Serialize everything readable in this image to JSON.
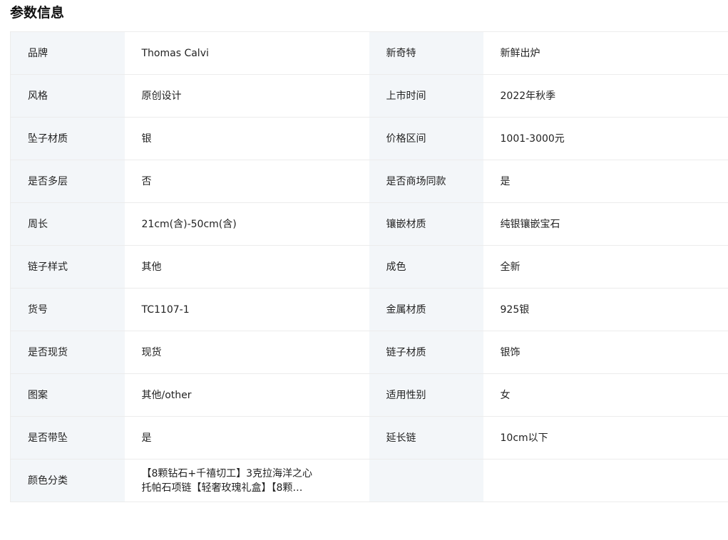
{
  "section": {
    "title": "参数信息"
  },
  "rows": [
    [
      {
        "label": "品牌",
        "value": "Thomas Calvi"
      },
      {
        "label": "新奇特",
        "value": "新鲜出炉"
      }
    ],
    [
      {
        "label": "风格",
        "value": "原创设计"
      },
      {
        "label": "上市时间",
        "value": "2022年秋季"
      }
    ],
    [
      {
        "label": "坠子材质",
        "value": "银"
      },
      {
        "label": "价格区间",
        "value": "1001-3000元"
      }
    ],
    [
      {
        "label": "是否多层",
        "value": "否"
      },
      {
        "label": "是否商场同款",
        "value": "是"
      }
    ],
    [
      {
        "label": "周长",
        "value": "21cm(含)-50cm(含)"
      },
      {
        "label": "镶嵌材质",
        "value": "纯银镶嵌宝石"
      }
    ],
    [
      {
        "label": "链子样式",
        "value": "其他"
      },
      {
        "label": "成色",
        "value": "全新"
      }
    ],
    [
      {
        "label": "货号",
        "value": "TC1107-1"
      },
      {
        "label": "金属材质",
        "value": "925银"
      }
    ],
    [
      {
        "label": "是否现货",
        "value": "现货"
      },
      {
        "label": "链子材质",
        "value": "银饰"
      }
    ],
    [
      {
        "label": "图案",
        "value": "其他/other"
      },
      {
        "label": "适用性别",
        "value": "女"
      }
    ],
    [
      {
        "label": "是否带坠",
        "value": "是"
      },
      {
        "label": "延长链",
        "value": "10cm以下"
      }
    ],
    [
      {
        "label": "颜色分类",
        "value_line1": "【8颗钻石+千禧切工】3克拉海洋之心",
        "value_line2": "托帕石项链【轻奢玫瑰礼盒】【8颗…"
      },
      {
        "label": "",
        "value": ""
      }
    ]
  ]
}
